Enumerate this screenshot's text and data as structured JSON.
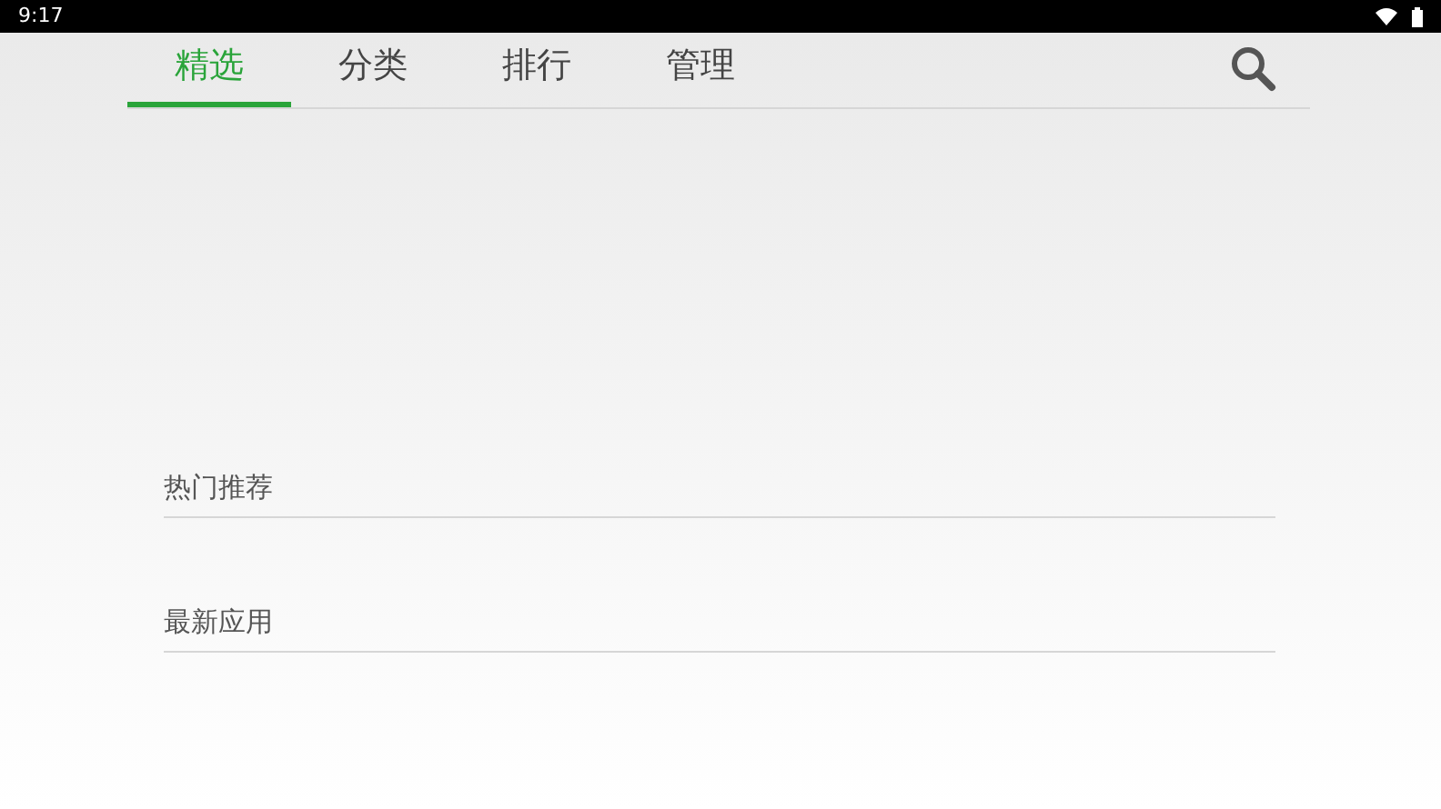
{
  "status_bar": {
    "time": "9:17"
  },
  "tabs": [
    {
      "label": "精选",
      "selected": true
    },
    {
      "label": "分类",
      "selected": false
    },
    {
      "label": "排行",
      "selected": false
    },
    {
      "label": "管理",
      "selected": false
    }
  ],
  "sections": [
    {
      "title": "热门推荐"
    },
    {
      "title": "最新应用"
    }
  ]
}
